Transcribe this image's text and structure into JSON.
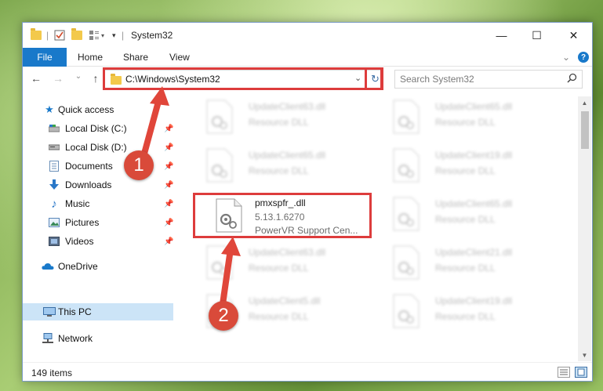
{
  "window": {
    "title": "System32",
    "controls": {
      "minimize": "—",
      "maximize": "☐",
      "close": "✕"
    }
  },
  "ribbon": {
    "tabs": [
      "File",
      "Home",
      "Share",
      "View"
    ],
    "collapse_glyph": "⌄",
    "help_glyph": "?"
  },
  "navigation": {
    "back": "←",
    "forward": "→",
    "recent": "⌄",
    "up": "↑",
    "address": "C:\\Windows\\System32",
    "dropdown": "⌄",
    "refresh": "↻",
    "search_placeholder": "Search System32"
  },
  "sidebar": {
    "quick_access": "Quick access",
    "items": [
      {
        "label": "Local Disk (C:)",
        "icon": "drive-icon",
        "pinned": true
      },
      {
        "label": "Local Disk (D:)",
        "icon": "drive-icon",
        "pinned": true
      },
      {
        "label": "Documents",
        "icon": "documents-icon",
        "pinned": true
      },
      {
        "label": "Downloads",
        "icon": "downloads-icon",
        "pinned": true
      },
      {
        "label": "Music",
        "icon": "music-icon",
        "pinned": true
      },
      {
        "label": "Pictures",
        "icon": "pictures-icon",
        "pinned": true
      },
      {
        "label": "Videos",
        "icon": "videos-icon",
        "pinned": true
      }
    ],
    "onedrive": "OneDrive",
    "this_pc": "This PC",
    "network": "Network",
    "pin_glyph": "📌"
  },
  "files": [
    {
      "name": "UpdateClient63.dll",
      "desc": "Resource DLL"
    },
    {
      "name": "UpdateClient65.dll",
      "desc": "Resource DLL"
    },
    {
      "name": "UpdateClient65.dll",
      "desc": "Resource DLL"
    },
    {
      "name": "UpdateClient19.dll",
      "desc": "Resource DLL"
    },
    {
      "name": "pmxspfr_.dll",
      "version": "5.13.1.6270",
      "desc": "PowerVR Support Cen..."
    },
    {
      "name": "UpdateClient65.dll",
      "desc": "Resource DLL"
    },
    {
      "name": "UpdateClient63.dll",
      "desc": "Resource DLL"
    },
    {
      "name": "UpdateClient21.dll",
      "desc": "Resource DLL"
    },
    {
      "name": "UpdateClient5.dll",
      "desc": "Resource DLL"
    },
    {
      "name": "UpdateClient19.dll",
      "desc": "Resource DLL"
    }
  ],
  "status": {
    "item_count": "149 items"
  },
  "annotations": {
    "badge_1": "1",
    "badge_2": "2",
    "color": "#dd3c3c"
  },
  "colors": {
    "accent": "#1979ca",
    "selected": "#cce4f7",
    "folder": "#f3c94b"
  }
}
